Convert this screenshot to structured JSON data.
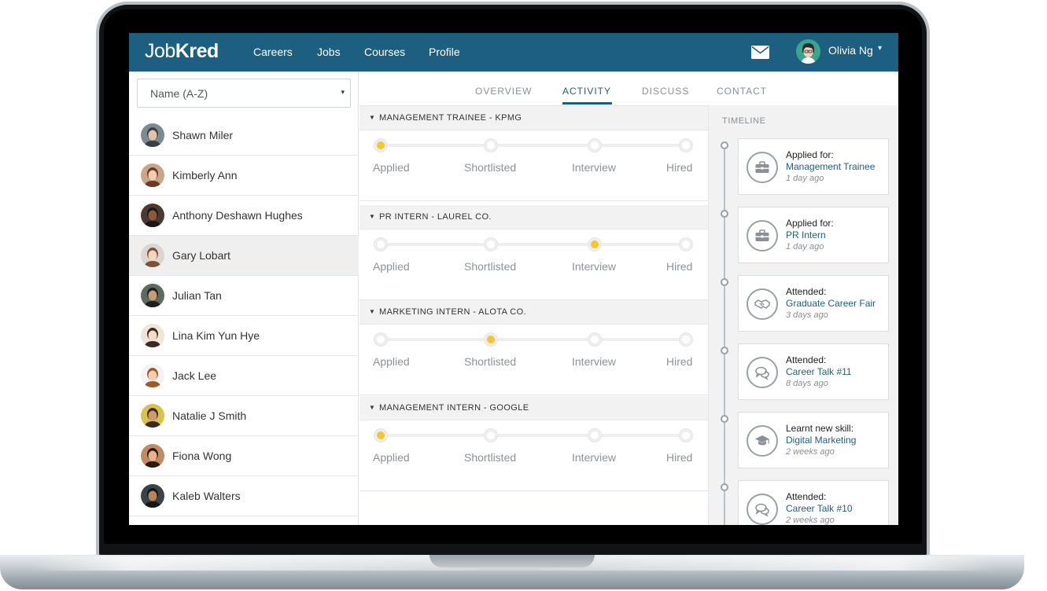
{
  "app": {
    "logo_part1": "Job",
    "logo_part2": "Kred"
  },
  "nav": {
    "links": [
      "Careers",
      "Jobs",
      "Courses",
      "Profile"
    ],
    "user_name": "Olivia Ng",
    "user_caret": "▾"
  },
  "sidebar": {
    "sort_value": "Name (A-Z)",
    "sort_caret": "▾",
    "people": [
      {
        "name": "Shawn Miler"
      },
      {
        "name": "Kimberly Ann"
      },
      {
        "name": "Anthony Deshawn Hughes"
      },
      {
        "name": "Gary Lobart"
      },
      {
        "name": "Julian Tan"
      },
      {
        "name": "Lina Kim Yun Hye"
      },
      {
        "name": "Jack Lee"
      },
      {
        "name": "Natalie J Smith"
      },
      {
        "name": "Fiona Wong"
      },
      {
        "name": "Kaleb Walters"
      }
    ],
    "selected_index": 3
  },
  "tabs": [
    "OVERVIEW",
    "ACTIVITY",
    "DISCUSS",
    "CONTACT"
  ],
  "active_tab": "ACTIVITY",
  "applications": [
    {
      "title": "MANAGEMENT TRAINEE - KPMG",
      "current_step": 0
    },
    {
      "title": "PR INTERN - LAUREL CO.",
      "current_step": 2
    },
    {
      "title": "MARKETING INTERN - ALOTA CO.",
      "current_step": 1
    },
    {
      "title": "MANAGEMENT INTERN  - GOOGLE",
      "current_step": 0
    }
  ],
  "steps": [
    "Applied",
    "Shortlisted",
    "Interview",
    "Hired"
  ],
  "caret_glyph": "▼",
  "timeline": {
    "title": "TIMELINE",
    "items": [
      {
        "action": "Applied for:",
        "item": "Management Trainee",
        "time": "1 day ago",
        "icon": "briefcase-icon"
      },
      {
        "action": "Applied for:",
        "item": "PR Intern",
        "time": "1 day ago",
        "icon": "briefcase-icon"
      },
      {
        "action": "Attended:",
        "item": "Graduate Career Fair",
        "time": "3 days ago",
        "icon": "handshake-icon"
      },
      {
        "action": "Attended:",
        "item": "Career Talk #11",
        "time": "8 days ago",
        "icon": "chat-icon"
      },
      {
        "action": "Learnt new skill:",
        "item": "Digital Marketing",
        "time": "2 weeks ago",
        "icon": "graduation-cap-icon"
      },
      {
        "action": "Attended:",
        "item": "Career Talk #10",
        "time": "2 weeks ago",
        "icon": "chat-icon"
      }
    ]
  },
  "colors": {
    "navbar": "#1d5f80",
    "accent": "#1d5f80",
    "step_active": "#f6c728"
  }
}
